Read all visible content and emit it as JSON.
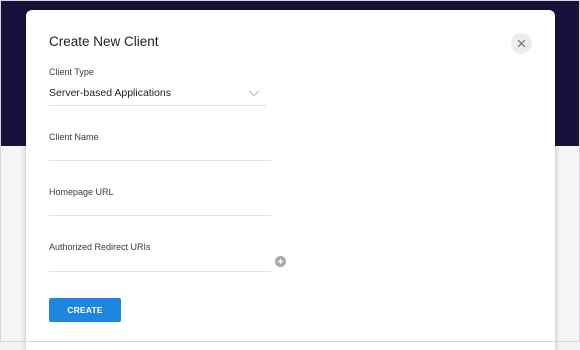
{
  "modal": {
    "title": "Create New Client",
    "close_icon": "close-icon"
  },
  "form": {
    "client_type": {
      "label": "Client Type",
      "value": "Server-based Applications",
      "icon": "chevron-down-icon"
    },
    "client_name": {
      "label": "Client Name",
      "value": ""
    },
    "homepage_url": {
      "label": "Homepage URL",
      "value": ""
    },
    "redirect_uris": {
      "label": "Authorized Redirect URIs",
      "value": "",
      "add_icon": "plus-circle-icon"
    },
    "create_label": "CREATE"
  },
  "colors": {
    "backdrop": "#17123c",
    "accent": "#1f86e0"
  }
}
